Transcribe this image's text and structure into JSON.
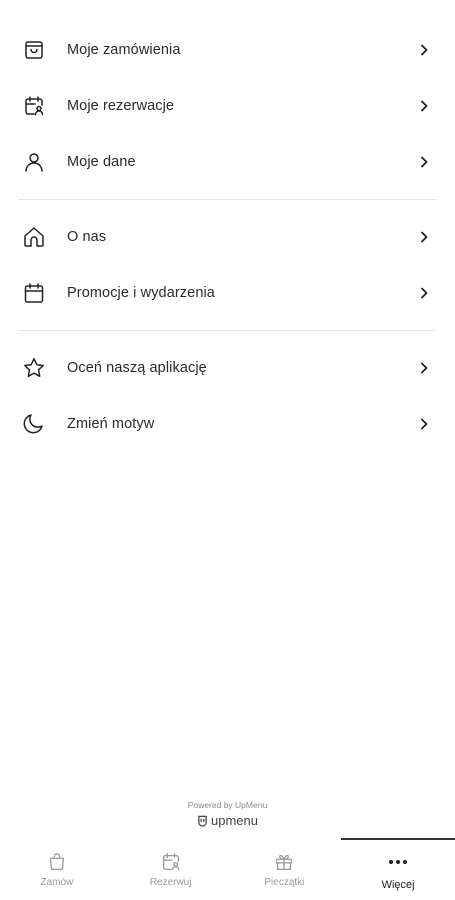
{
  "menu": {
    "group1": [
      {
        "label": "Moje zamówienia",
        "icon": "shopping-bag-icon"
      },
      {
        "label": "Moje rezerwacje",
        "icon": "calendar-user-icon"
      },
      {
        "label": "Moje dane",
        "icon": "user-icon"
      }
    ],
    "group2": [
      {
        "label": "O nas",
        "icon": "home-icon"
      },
      {
        "label": "Promocje i wydarzenia",
        "icon": "calendar-icon"
      }
    ],
    "group3": [
      {
        "label": "Oceń naszą aplikację",
        "icon": "star-icon"
      },
      {
        "label": "Zmień motyw",
        "icon": "moon-icon"
      }
    ]
  },
  "footer": {
    "powered_by": "Powered by UpMenu",
    "brand": "upmenu"
  },
  "tabbar": {
    "items": [
      {
        "label": "Zamów",
        "icon": "shopping-bag-icon",
        "active": false
      },
      {
        "label": "Rezerwuj",
        "icon": "calendar-user-icon",
        "active": false
      },
      {
        "label": "Pieczątki",
        "icon": "gift-icon",
        "active": false
      },
      {
        "label": "Więcej",
        "icon": "more-dots-icon",
        "active": true
      }
    ]
  }
}
